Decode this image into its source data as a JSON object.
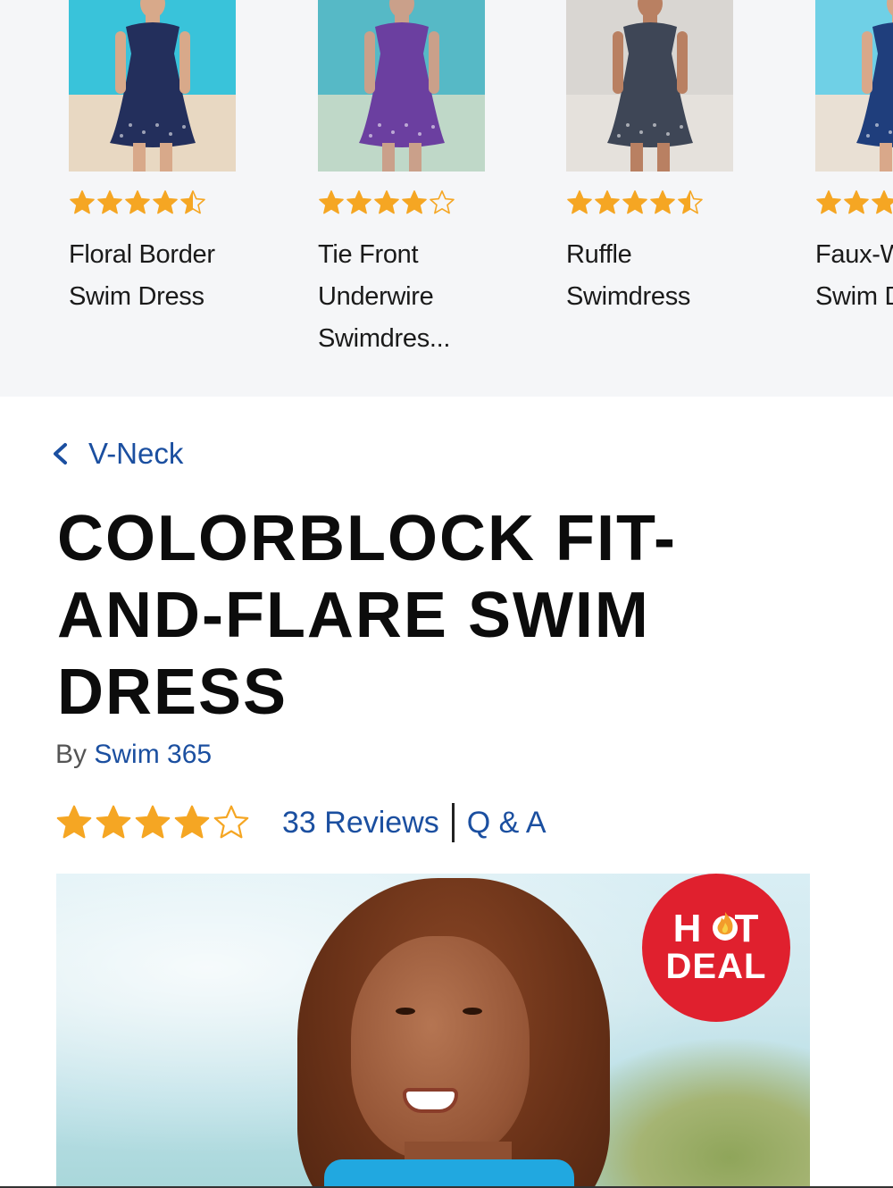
{
  "recommendations": [
    {
      "name": "Floral Border Swim Dress",
      "rating": 4.5,
      "colors": {
        "sky": "#39c3da",
        "sand": "#e8d8c2",
        "dress": "#232f5c",
        "skin": "#d8a98a"
      }
    },
    {
      "name": "Tie Front Underwire Swimdres...",
      "rating": 4,
      "colors": {
        "sky": "#56b9c6",
        "sand": "#bfd8c8",
        "dress": "#6b3fa0",
        "skin": "#caa08a"
      }
    },
    {
      "name": "Ruffle Swimdress",
      "rating": 4.5,
      "colors": {
        "sky": "#d9d6d2",
        "sand": "#e5e1dc",
        "dress": "#3e4656",
        "skin": "#b98062"
      }
    },
    {
      "name": "Faux-Wrap Swim Dress",
      "rating": 4,
      "colors": {
        "sky": "#6fd0e6",
        "sand": "#e9e0d4",
        "dress": "#1f3e7c",
        "skin": "#d9a88a"
      }
    }
  ],
  "breadcrumb": {
    "back_label": "V-Neck"
  },
  "product": {
    "title": "COLORBLOCK FIT-AND-FLARE SWIM DRESS",
    "by_prefix": "By",
    "brand": "Swim 365",
    "rating": 4,
    "reviews_label": "33 Reviews",
    "qa_label": "Q & A"
  },
  "badge": {
    "line1_left": "H",
    "line1_right": "T",
    "line2": "DEAL"
  },
  "colors": {
    "link": "#1b4fa0",
    "star": "#f5a623",
    "badge": "#e0202e",
    "carousel_bg": "#f5f6f8"
  }
}
